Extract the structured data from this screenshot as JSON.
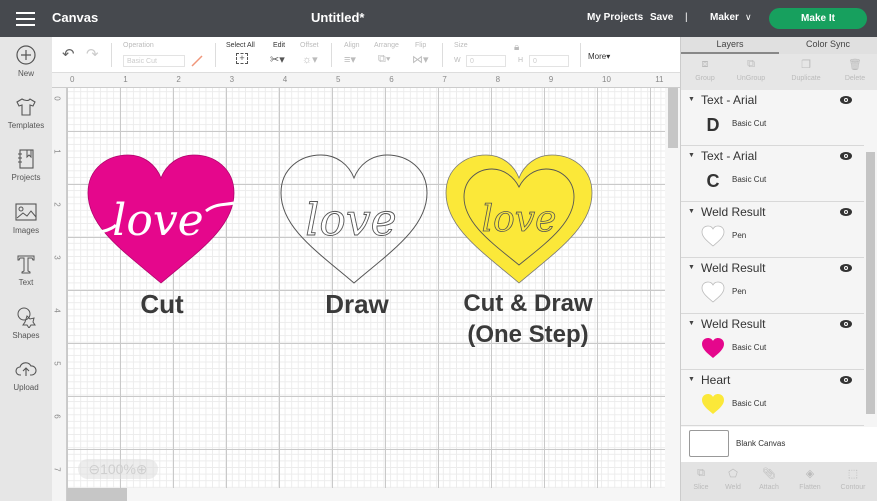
{
  "header": {
    "app_title": "Canvas",
    "doc_title": "Untitled*",
    "my_projects": "My Projects",
    "save": "Save",
    "divider": "|",
    "machine": "Maker",
    "machine_chevron": "∨",
    "make_it": "Make It",
    "brand_color": "#17a05e"
  },
  "sidebar": {
    "items": [
      {
        "label": "New",
        "icon": "plus-circle-icon"
      },
      {
        "label": "Templates",
        "icon": "tshirt-icon"
      },
      {
        "label": "Projects",
        "icon": "notebook-icon"
      },
      {
        "label": "Images",
        "icon": "image-icon"
      },
      {
        "label": "Text",
        "icon": "text-t-icon"
      },
      {
        "label": "Shapes",
        "icon": "shapes-icon"
      },
      {
        "label": "Upload",
        "icon": "cloud-upload-icon"
      }
    ]
  },
  "toolbar": {
    "operation_label": "Operation",
    "operation_value": "Basic Cut",
    "select_all": "Select All",
    "edit": "Edit",
    "offset": "Offset",
    "align": "Align",
    "arrange": "Arrange",
    "flip": "Flip",
    "size": "Size",
    "w_label": "W",
    "w_value": "0",
    "h_label": "H",
    "h_value": "0",
    "more": "More▾"
  },
  "canvas": {
    "ruler_top": [
      "0",
      "1",
      "2",
      "3",
      "4",
      "5",
      "6",
      "7",
      "8",
      "9",
      "10",
      "11"
    ],
    "ruler_left": [
      "0",
      "1",
      "2",
      "3",
      "4",
      "5",
      "6",
      "7"
    ],
    "zoom_level": "100%",
    "artwork": [
      {
        "label": "Cut",
        "fill": "#e5078c",
        "script_text": "love"
      },
      {
        "label": "Draw",
        "fill": "none",
        "script_text": "love"
      },
      {
        "label_line1": "Cut & Draw",
        "label_line2": "(One Step)",
        "fill": "#fbe839",
        "script_text": "love"
      }
    ]
  },
  "panel": {
    "tabs": [
      "Layers",
      "Color Sync"
    ],
    "actions": [
      "Group",
      "UnGroup",
      "Duplicate",
      "Delete"
    ],
    "layers": [
      {
        "name": "Text - Arial",
        "thumb": "D",
        "operation": "Basic Cut"
      },
      {
        "name": "Text - Arial",
        "thumb": "C",
        "operation": "Basic Cut"
      },
      {
        "name": "Weld Result",
        "thumb": "heart-outline",
        "operation": "Pen"
      },
      {
        "name": "Weld Result",
        "thumb": "heart-outline",
        "operation": "Pen"
      },
      {
        "name": "Weld Result",
        "thumb": "heart-pink",
        "operation": "Basic Cut"
      },
      {
        "name": "Heart",
        "thumb": "heart-yellow",
        "operation": "Basic Cut"
      }
    ],
    "blank_canvas": "Blank Canvas",
    "bottom_actions": [
      "Slice",
      "Weld",
      "Attach",
      "Flatten",
      "Contour"
    ]
  }
}
